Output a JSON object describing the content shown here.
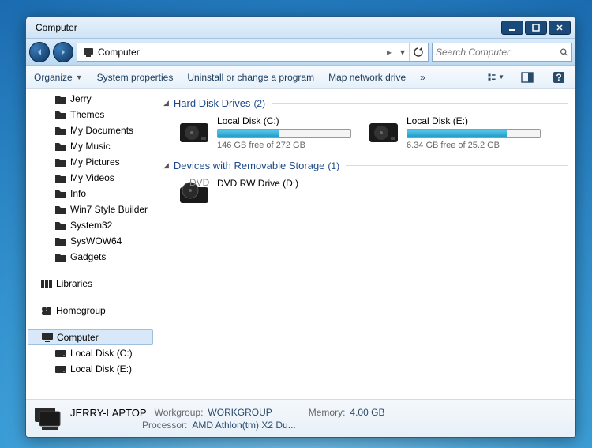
{
  "window": {
    "title": "Computer"
  },
  "titlebar_buttons": {
    "minimize": "minimize",
    "maximize": "maximize",
    "close": "close"
  },
  "address": {
    "location": "Computer",
    "separator": "▸"
  },
  "search": {
    "placeholder": "Search Computer"
  },
  "toolbar": {
    "organize": "Organize",
    "system_properties": "System properties",
    "uninstall": "Uninstall or change a program",
    "map_drive": "Map network drive",
    "more": "»"
  },
  "sidebar": {
    "folders": [
      {
        "label": "Jerry"
      },
      {
        "label": "Themes"
      },
      {
        "label": "My Documents"
      },
      {
        "label": "My Music"
      },
      {
        "label": "My Pictures"
      },
      {
        "label": "My Videos"
      },
      {
        "label": "Info"
      },
      {
        "label": "Win7 Style Builder"
      },
      {
        "label": "System32"
      },
      {
        "label": "SysWOW64"
      },
      {
        "label": "Gadgets"
      }
    ],
    "libraries": "Libraries",
    "homegroup": "Homegroup",
    "computer": "Computer",
    "computer_children": [
      {
        "label": "Local Disk (C:)"
      },
      {
        "label": "Local Disk (E:)"
      }
    ]
  },
  "groups": {
    "hdd": {
      "title": "Hard Disk Drives",
      "count": "(2)"
    },
    "removable": {
      "title": "Devices with Removable Storage",
      "count": "(1)"
    }
  },
  "drives": {
    "hdd": [
      {
        "name": "Local Disk (C:)",
        "free": "146 GB free of 272 GB",
        "fill_pct": 46
      },
      {
        "name": "Local Disk (E:)",
        "free": "6.34 GB free of 25.2 GB",
        "fill_pct": 75
      }
    ],
    "removable": [
      {
        "name": "DVD RW Drive (D:)"
      }
    ]
  },
  "details": {
    "name": "JERRY-LAPTOP",
    "workgroup_label": "Workgroup:",
    "workgroup": "WORKGROUP",
    "memory_label": "Memory:",
    "memory": "4.00 GB",
    "processor_label": "Processor:",
    "processor": "AMD Athlon(tm) X2 Du..."
  }
}
